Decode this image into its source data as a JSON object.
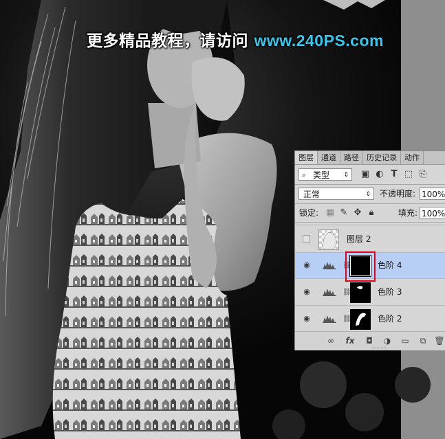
{
  "watermark": {
    "text_cn": "更多精品教程，请访问 ",
    "url": "www.240PS.com",
    "url_color": "#37c8ec"
  },
  "layers_panel": {
    "tabs": [
      "图层",
      "通道",
      "路径",
      "历史记录",
      "动作"
    ],
    "active_tab": "图层",
    "filter": {
      "search_icon": "search-icon",
      "label": "类型"
    },
    "blend_mode": "正常",
    "opacity": {
      "label": "不透明度:",
      "value": "100%"
    },
    "lock": {
      "label": "锁定:"
    },
    "fill": {
      "label": "填充:",
      "value": "100%"
    },
    "layers": [
      {
        "name": "图层 2",
        "visible": false,
        "type": "pixel",
        "selected": false
      },
      {
        "name": "色阶 4",
        "visible": true,
        "type": "levels",
        "selected": true,
        "mask": "black"
      },
      {
        "name": "色阶 3",
        "visible": true,
        "type": "levels",
        "selected": false,
        "mask": "small-white-shape"
      },
      {
        "name": "色阶 2",
        "visible": true,
        "type": "levels",
        "selected": false,
        "mask": "arm-white-shape"
      }
    ],
    "bottom_icons": [
      "link-layers-icon",
      "fx-icon",
      "add-mask-icon",
      "adjustment-layer-icon",
      "group-folder-icon",
      "new-layer-icon",
      "trash-icon"
    ],
    "highlight_color": "#e0001a",
    "selected_row_color": "#b8cff5"
  }
}
